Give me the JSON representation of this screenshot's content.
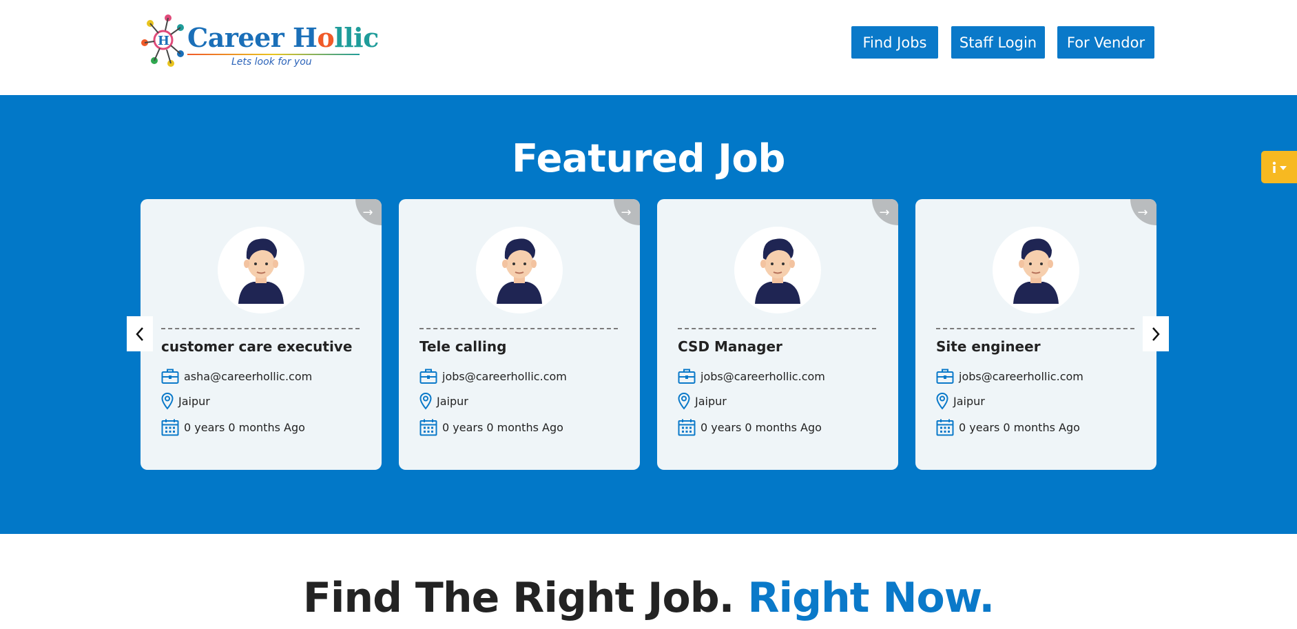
{
  "header": {
    "logo": {
      "title_part1": "Career H",
      "title_part2": "o",
      "title_part3": "llic",
      "tagline": "Lets look for you"
    },
    "nav": {
      "find_jobs": "Find Jobs",
      "staff_login": "Staff Login",
      "for_vendor": "For Vendor"
    }
  },
  "featured": {
    "title": "Featured Job",
    "cards": [
      {
        "title": "customer care executive",
        "email": "asha@careerhollic.com",
        "location": "Jaipur",
        "posted": "0 years 0 months Ago"
      },
      {
        "title": "Tele calling",
        "email": "jobs@careerhollic.com",
        "location": "Jaipur",
        "posted": "0 years 0 months Ago"
      },
      {
        "title": "CSD Manager",
        "email": "jobs@careerhollic.com",
        "location": "Jaipur",
        "posted": "0 years 0 months Ago"
      },
      {
        "title": "Site engineer",
        "email": "jobs@careerhollic.com",
        "location": "Jaipur",
        "posted": "0 years 0 months Ago"
      }
    ],
    "corner_arrow": "→",
    "prev_icon": "chevron-left-icon",
    "next_icon": "chevron-right-icon"
  },
  "side_widget": {
    "icon": "options-dropdown-icon"
  },
  "tagline_section": {
    "part1": "Find The Right Job.",
    "part2": "Right Now."
  },
  "colors": {
    "primary": "#0a79c9",
    "featured_bg": "#0278c8",
    "card_bg": "#eff5f8",
    "side_tab": "#f7b921",
    "text_dark": "#232323"
  }
}
